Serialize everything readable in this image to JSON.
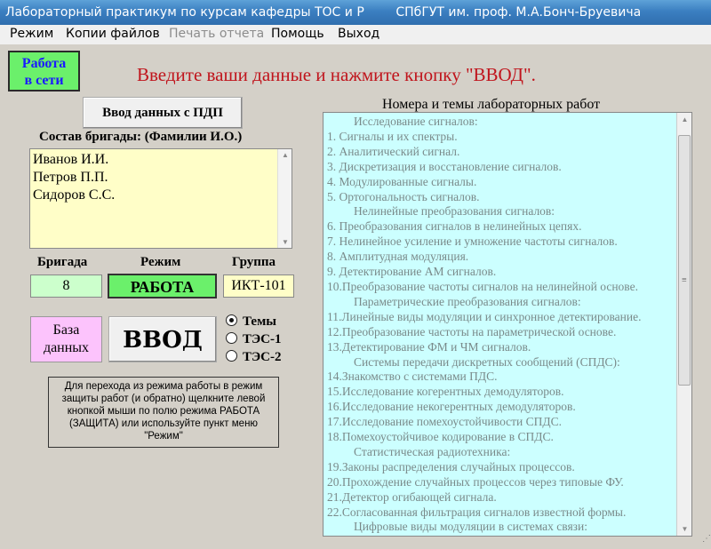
{
  "window": {
    "title": "Лабораторный практикум по курсам кафедры ТОС и Р        СПбГУТ им. проф. М.А.Бонч-Бруевича"
  },
  "menu": {
    "items": [
      "Режим",
      "Копии файлов",
      "Печать отчета",
      "Помощь",
      "Выход"
    ]
  },
  "network_badge": {
    "line1": "Работа",
    "line2": "в сети"
  },
  "prompt": "Введите ваши данные и нажмите кнопку \"ВВОД\".",
  "pdp_button": "Ввод данных с ПДП",
  "team": {
    "label": "Состав  бригады: (Фамилии И.О.)",
    "members": [
      "Иванов И.И.",
      "Петров П.П.",
      "Сидоров С.С."
    ]
  },
  "fields": {
    "brigade_label": "Бригада",
    "brigade_value": "8",
    "mode_label": "Режим",
    "mode_value": "РАБОТА",
    "group_label": "Группа",
    "group_value": "ИКТ-101"
  },
  "database_button": {
    "line1": "База",
    "line2": "данных"
  },
  "enter_button": "ВВОД",
  "radio": {
    "options": [
      "Темы",
      "ТЭС-1",
      "ТЭС-2"
    ],
    "selected": "Темы"
  },
  "hint": "Для перехода из режима работы в режим защиты работ (и обратно) щелкните левой кнопкой мыши по полю режима РАБОТА (ЗАЩИТА) или используйте пункт меню \"Режим\"",
  "labs": {
    "title": "Номера и темы лабораторных работ",
    "lines": [
      "Исследование сигналов:",
      "1. Сигналы и их спектры.",
      "2. Аналитический сигнал.",
      "3. Дискретизация и восстановление сигналов.",
      "4. Модулированные сигналы.",
      "5. Ортогональность сигналов.",
      "Нелинейные преобразования сигналов:",
      "6. Преобразования сигналов в нелинейных цепях.",
      "7. Нелинейное усиление и умножение частоты сигналов.",
      "8. Амплитудная модуляция.",
      "9. Детектирование АМ сигналов.",
      "10.Преобразование частоты сигналов на нелинейной основе.",
      "Параметрические преобразования сигналов:",
      "11.Линейные виды модуляции и синхронное детектирование.",
      "12.Преобразование частоты на параметрической основе.",
      "13.Детектирование ФМ и ЧМ сигналов.",
      "Системы передачи дискретных сообщений (СПДС):",
      "14.Знакомство с системами ПДС.",
      "15.Исследование когерентных демодуляторов.",
      "16.Исследование некогерентных демодуляторов.",
      "17.Исследование помехоустойчивости СПДС.",
      "18.Помехоустойчивое кодирование в СПДС.",
      "Статистическая радиотехника:",
      "19.Законы распределения случайных процессов.",
      "20.Прохождение случайных процессов через типовые ФУ.",
      "21.Детектор огибающей сигнала.",
      "22.Согласованная фильтрация сигналов известной формы.",
      "Цифровые виды модуляции в системах связи:"
    ],
    "section_indices": [
      0,
      6,
      12,
      16,
      22,
      27
    ]
  }
}
